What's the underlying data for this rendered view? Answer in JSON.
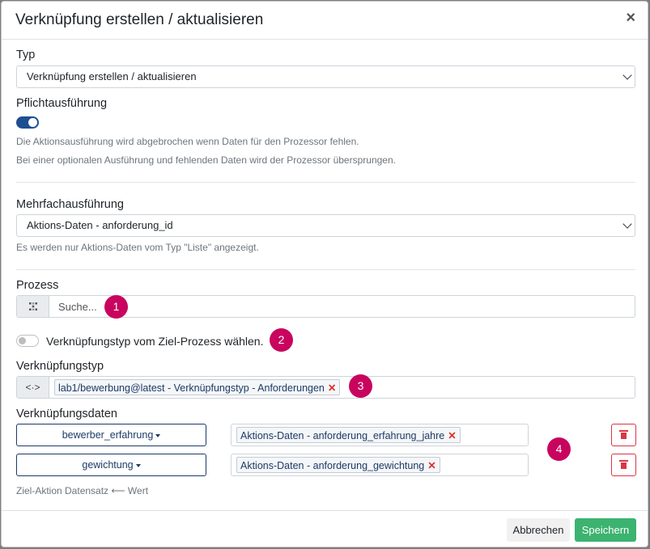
{
  "modal": {
    "title": "Verknüpfung erstellen / aktualisieren",
    "close_glyph": "×"
  },
  "typ": {
    "label": "Typ",
    "value": "Verknüpfung erstellen / aktualisieren"
  },
  "pflicht": {
    "label": "Pflichtausführung",
    "enabled": true,
    "help1": "Die Aktionsausführung wird abgebrochen wenn Daten für den Prozessor fehlen.",
    "help2": "Bei einer optionalen Ausführung und fehlenden Daten wird der Prozessor übersprungen."
  },
  "mehrfach": {
    "label": "Mehrfachausführung",
    "value": "Aktions-Daten - anforderung_id",
    "help": "Es werden nur Aktions-Daten vom Typ \"Liste\" angezeigt."
  },
  "prozess": {
    "label": "Prozess",
    "placeholder": "Suche..."
  },
  "ziel_toggle": {
    "label": "Verknüpfungstyp vom Ziel-Prozess wählen.",
    "enabled": false
  },
  "verknuepfungstyp": {
    "label": "Verknüpfungstyp",
    "tag": "lab1/bewerbung@latest - Verknüpfungstyp - Anforderungen"
  },
  "verknuepfungsdaten": {
    "label": "Verknüpfungsdaten",
    "rows": [
      {
        "field": "bewerber_erfahrung",
        "value": "Aktions-Daten - anforderung_erfahrung_jahre"
      },
      {
        "field": "gewichtung",
        "value": "Aktions-Daten - anforderung_gewichtung"
      }
    ],
    "help": "Ziel-Aktion Datensatz ⟵ Wert"
  },
  "badges": [
    "1",
    "2",
    "3",
    "4"
  ],
  "footer": {
    "cancel_label": "Abbrechen",
    "save_label": "Speichern"
  },
  "colors": {
    "primary": "#1d4f91",
    "badge": "#c8045e",
    "save": "#3cb371",
    "danger": "#dc3545"
  }
}
